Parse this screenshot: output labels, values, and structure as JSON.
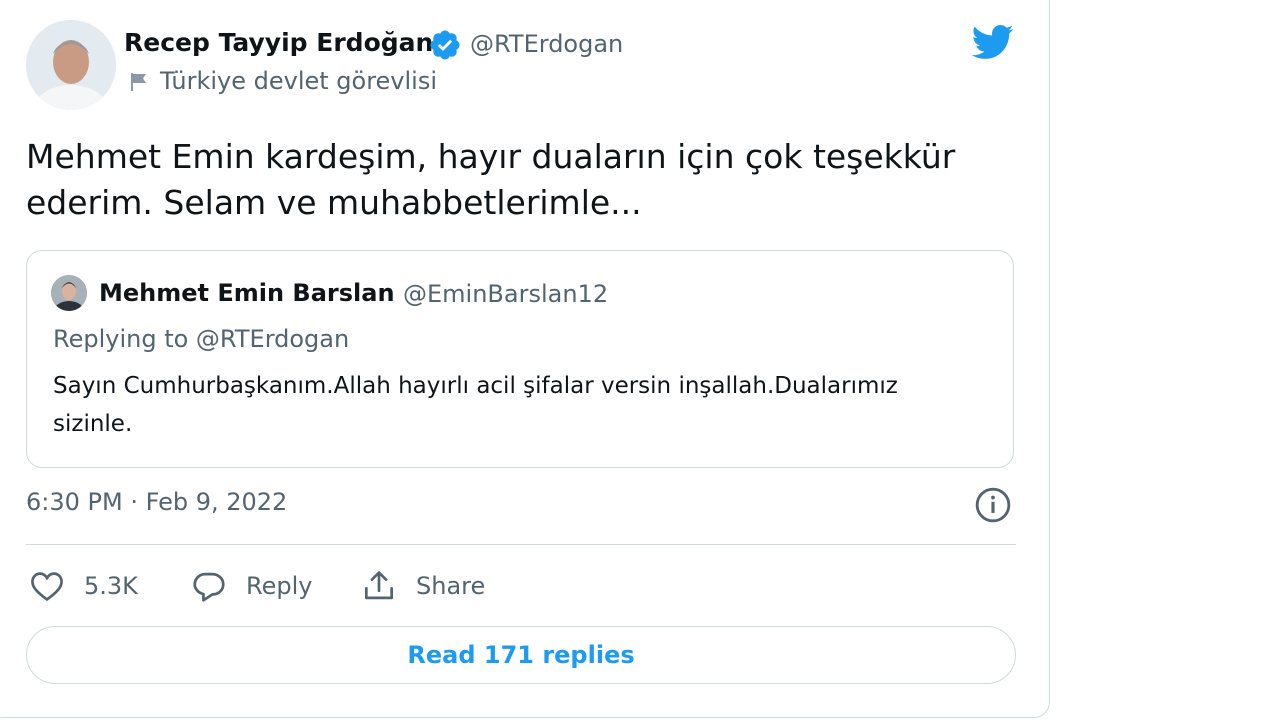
{
  "author": {
    "name": "Recep Tayyip Erdoğan",
    "handle": "@RTErdogan",
    "label": "Türkiye devlet görevlisi",
    "verified_icon": "verified-badge-icon",
    "label_icon": "flag-icon"
  },
  "tweet": {
    "text": "Mehmet Emin kardeşim, hayır duaların için çok teşekkür ederim. Selam ve muhabbetlerimle...",
    "timestamp": "6:30 PM · Feb 9, 2022"
  },
  "quoted": {
    "name": "Mehmet Emin Barslan",
    "handle": "@EminBarslan12",
    "replying_to": "Replying to @RTErdogan",
    "text": "Sayın Cumhurbaşkanım.Allah hayırlı acil şifalar versin inşallah.Dualarımız sizinle."
  },
  "actions": {
    "like_count": "5.3K",
    "reply_label": "Reply",
    "share_label": "Share",
    "read_replies_label": "Read 171 replies"
  },
  "icons": {
    "logo": "twitter-logo-icon",
    "info": "info-icon",
    "like": "heart-icon",
    "reply": "reply-bubble-icon",
    "share": "share-icon"
  },
  "colors": {
    "accent": "#1d9bf0",
    "secondary_text": "#536471",
    "border": "#cfd9de"
  }
}
